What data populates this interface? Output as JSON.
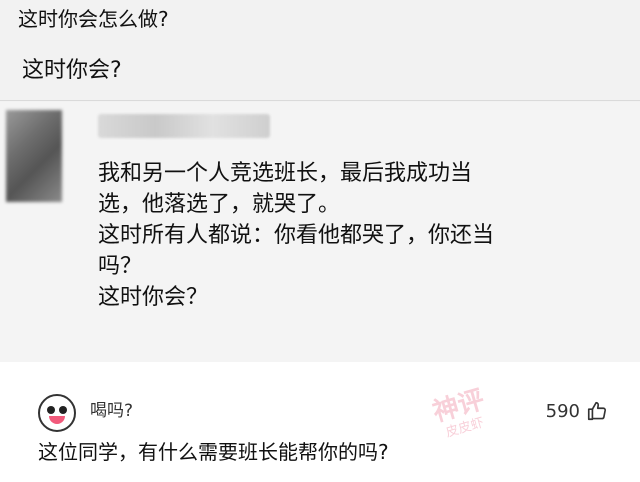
{
  "post": {
    "question_1": "这时你会怎么做?",
    "question_2": "这时你会?"
  },
  "card": {
    "content_lines": [
      "我和另一个人竞选班长，最后我成功当",
      "选，他落选了，就哭了。",
      "这时所有人都说：你看他都哭了，你还当",
      "吗？",
      "这时你会？"
    ]
  },
  "comment": {
    "username": "喝吗?",
    "likes": "590",
    "text": "这位同学，有什么需要班长能帮你的吗?"
  },
  "watermark": {
    "line1": "神评",
    "line2": "皮皮虾"
  },
  "icons": {
    "like": "thumbs-up-icon",
    "avatar": "emoji-avatar-icon"
  }
}
